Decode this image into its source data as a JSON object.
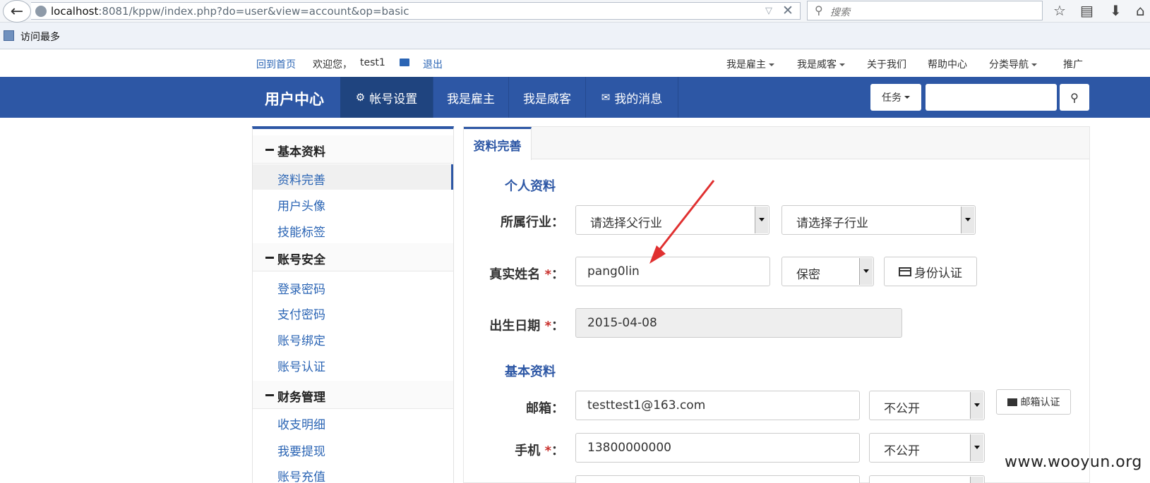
{
  "browser": {
    "url_host": "localhost",
    "url_rest": ":8081/kppw/index.php?do=user&view=account&op=basic",
    "search_placeholder": "搜索",
    "bookmark_label": "访问最多"
  },
  "top_links": {
    "home": "回到首页",
    "welcome": "欢迎您，",
    "username": "test1",
    "logout": "退出",
    "right": [
      "我是雇主",
      "我是威客",
      "关于我们",
      "帮助中心",
      "分类导航",
      "推广"
    ]
  },
  "nav": {
    "brand": "用户中心",
    "tabs": [
      "帐号设置",
      "我是雇主",
      "我是威客",
      "我的消息"
    ],
    "task_dropdown": "任务"
  },
  "sidebar": {
    "sections": [
      {
        "title": "基本资料",
        "items": [
          "资料完善",
          "用户头像",
          "技能标签"
        ]
      },
      {
        "title": "账号安全",
        "items": [
          "登录密码",
          "支付密码",
          "账号绑定",
          "账号认证"
        ]
      },
      {
        "title": "财务管理",
        "items": [
          "收支明细",
          "我要提现",
          "账号充值"
        ]
      }
    ]
  },
  "panel": {
    "tab": "资料完善",
    "personal_title": "个人资料",
    "basic_title": "基本资料",
    "industry_label": "所属行业：",
    "parent_industry": "请选择父行业",
    "child_industry": "请选择子行业",
    "realname_label": "真实姓名",
    "realname_value": "pang0lin",
    "privacy_option": "保密",
    "id_verify_button": "身份认证",
    "birth_label": "出生日期",
    "birth_value": "2015-04-08",
    "email_label": "邮箱：",
    "email_value": "testtest1@163.com",
    "email_privacy": "不公开",
    "email_verify_button": "邮箱认证",
    "phone_label": "手机",
    "phone_value": "13800000000",
    "phone_privacy": "不公开",
    "required_mark": "*",
    "colon": "："
  },
  "watermark": "www.wooyun.org",
  "colors": {
    "nav_blue": "#2d57a5",
    "link_blue": "#2a64b4",
    "arrow_red": "#e03030"
  }
}
